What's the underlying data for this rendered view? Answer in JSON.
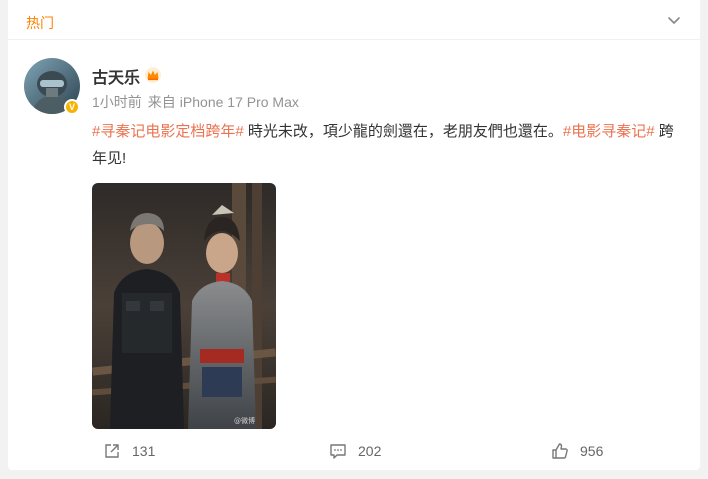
{
  "section": {
    "title": "热门"
  },
  "post": {
    "author": "古天乐",
    "time": "1小时前",
    "from": "来自",
    "device": "iPhone 17 Pro Max",
    "text_parts": [
      {
        "type": "hashtag",
        "text": "#寻秦记电影定档跨年#"
      },
      {
        "type": "text",
        "text": " 時光未改，項少龍的劍還在，老朋友們也還在。"
      },
      {
        "type": "hashtag",
        "text": "#电影寻秦记#"
      },
      {
        "type": "text",
        "text": " 跨年见!"
      }
    ],
    "image_watermark": "@微博"
  },
  "actions": {
    "repost_count": "131",
    "comment_count": "202",
    "like_count": "956"
  },
  "colors": {
    "accent": "#ff8200",
    "hashtag": "#eb7350",
    "muted": "#939393"
  },
  "icons": [
    "chevron-down-icon",
    "crown-icon",
    "verified-icon",
    "repost-icon",
    "comment-icon",
    "like-icon"
  ]
}
